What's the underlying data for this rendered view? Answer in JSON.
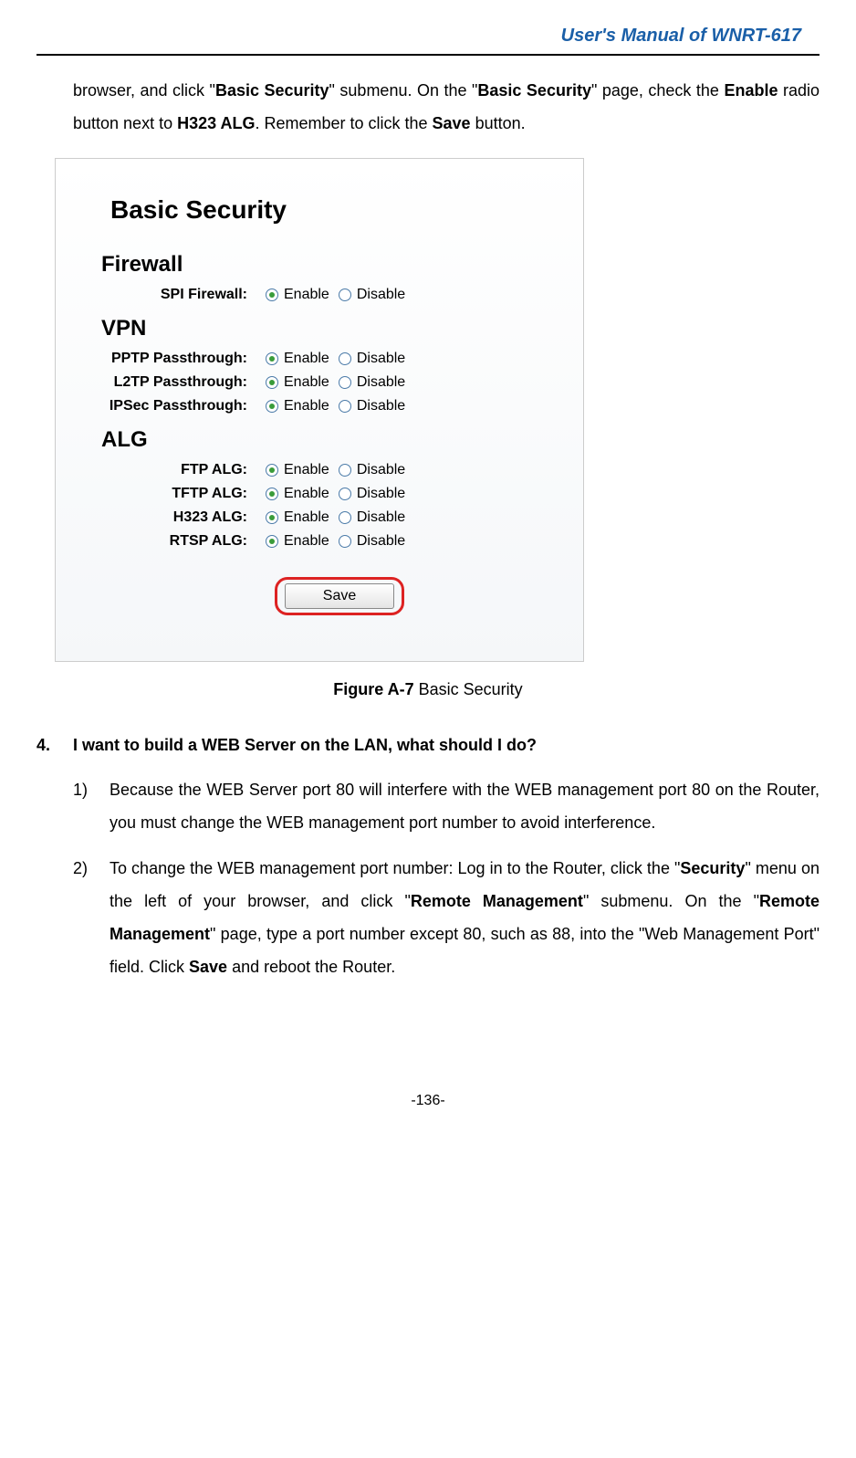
{
  "header": {
    "manual_title": "User's Manual of WNRT-617"
  },
  "intro": {
    "t1": "browser, and click \"",
    "b1": "Basic Security",
    "t2": "\" submenu. On the \"",
    "b2": "Basic Security",
    "t3": "\" page, check the ",
    "b3": "Enable",
    "t4": " radio button next to ",
    "b4": "H323 ALG",
    "t5": ". Remember to click the ",
    "b5": "Save",
    "t6": " button."
  },
  "screenshot": {
    "title": "Basic Security",
    "firewall_h": "Firewall",
    "vpn_h": "VPN",
    "alg_h": "ALG",
    "enable": "Enable",
    "disable": "Disable",
    "rows": {
      "spi": "SPI Firewall:",
      "pptp": "PPTP Passthrough:",
      "l2tp": "L2TP Passthrough:",
      "ipsec": "IPSec Passthrough:",
      "ftp": "FTP ALG:",
      "tftp": "TFTP ALG:",
      "h323": "H323 ALG:",
      "rtsp": "RTSP ALG:"
    },
    "save": "Save"
  },
  "figure": {
    "num": "Figure A-7",
    "caption": " Basic Security"
  },
  "q4": {
    "num": "4.",
    "text": "I want to build a WEB Server on the LAN, what should I do?",
    "item1_num": "1)",
    "item1_text": "Because the WEB Server port 80 will interfere with the WEB management port 80 on the Router, you must change the WEB management port number to avoid interference.",
    "item2_num": "2)",
    "item2": {
      "t1": "To change the WEB management port number: Log in to the Router, click the \"",
      "b1": "Security",
      "t2": "\" menu on the left of your browser, and click \"",
      "b2": "Remote Management",
      "t3": "\" submenu. On the \"",
      "b3": "Remote Management",
      "t4": "\" page, type a port number except 80, such as 88, into the \"Web Management Port\" field. Click ",
      "b4": "Save",
      "t5": " and reboot the Router."
    }
  },
  "pagenum": "-136-"
}
